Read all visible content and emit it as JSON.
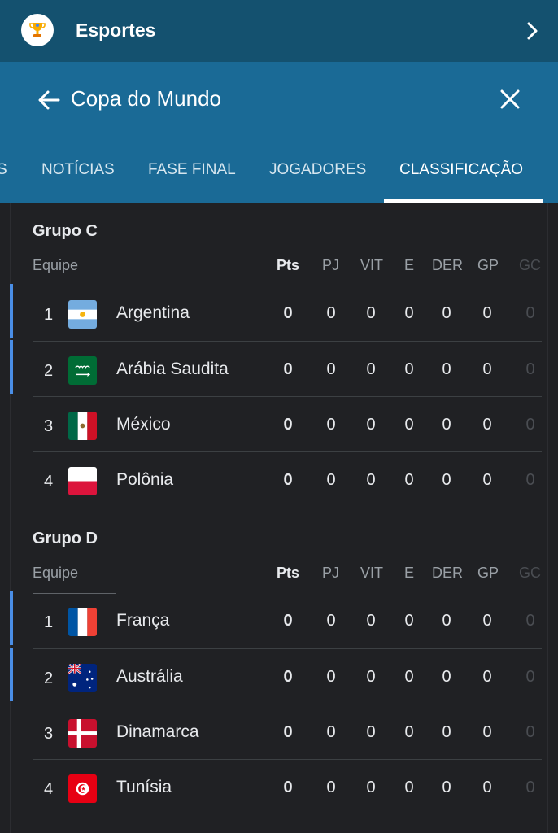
{
  "top_bar": {
    "title": "Esportes",
    "icon": "trophy-icon",
    "chevron_icon": "chevron-right-icon"
  },
  "header": {
    "title": "Copa do Mundo",
    "back_icon": "arrow-left-icon",
    "close_icon": "close-icon"
  },
  "tabs": [
    {
      "label": "S",
      "active": false
    },
    {
      "label": "NOTÍCIAS",
      "active": false
    },
    {
      "label": "FASE FINAL",
      "active": false
    },
    {
      "label": "JOGADORES",
      "active": false
    },
    {
      "label": "CLASSIFICAÇÃO",
      "active": true
    }
  ],
  "columns": [
    "Equipe",
    "Pts",
    "PJ",
    "VIT",
    "E",
    "DER",
    "GP",
    "GC"
  ],
  "groups": [
    {
      "title": "Grupo C",
      "teams": [
        {
          "pos": "1",
          "name": "Argentina",
          "flag": "argentina-flag-icon",
          "stats": [
            "0",
            "0",
            "0",
            "0",
            "0",
            "0",
            "0"
          ],
          "qualified": true
        },
        {
          "pos": "2",
          "name": "Arábia Saudita",
          "flag": "saudi-arabia-flag-icon",
          "stats": [
            "0",
            "0",
            "0",
            "0",
            "0",
            "0",
            "0"
          ],
          "qualified": true
        },
        {
          "pos": "3",
          "name": "México",
          "flag": "mexico-flag-icon",
          "stats": [
            "0",
            "0",
            "0",
            "0",
            "0",
            "0",
            "0"
          ],
          "qualified": false
        },
        {
          "pos": "4",
          "name": "Polônia",
          "flag": "poland-flag-icon",
          "stats": [
            "0",
            "0",
            "0",
            "0",
            "0",
            "0",
            "0"
          ],
          "qualified": false
        }
      ]
    },
    {
      "title": "Grupo D",
      "teams": [
        {
          "pos": "1",
          "name": "França",
          "flag": "france-flag-icon",
          "stats": [
            "0",
            "0",
            "0",
            "0",
            "0",
            "0",
            "0"
          ],
          "qualified": true
        },
        {
          "pos": "2",
          "name": "Austrália",
          "flag": "australia-flag-icon",
          "stats": [
            "0",
            "0",
            "0",
            "0",
            "0",
            "0",
            "0"
          ],
          "qualified": true
        },
        {
          "pos": "3",
          "name": "Dinamarca",
          "flag": "denmark-flag-icon",
          "stats": [
            "0",
            "0",
            "0",
            "0",
            "0",
            "0",
            "0"
          ],
          "qualified": false
        },
        {
          "pos": "4",
          "name": "Tunísia",
          "flag": "tunisia-flag-icon",
          "stats": [
            "0",
            "0",
            "0",
            "0",
            "0",
            "0",
            "0"
          ],
          "qualified": false
        }
      ]
    }
  ],
  "colors": {
    "top_bar": "#14516f",
    "header": "#1a6a96",
    "background": "#202124",
    "qualified_marker": "#4a8ee6"
  }
}
